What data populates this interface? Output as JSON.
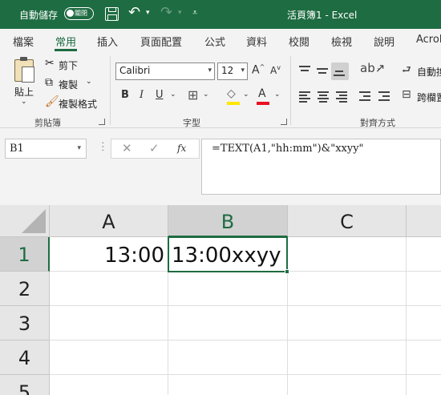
{
  "titlebar": {
    "autosave_label": "自動儲存",
    "autosave_state": "關閉",
    "document_title": "活頁簿1 - Excel",
    "background": "#1e6c41"
  },
  "tabs": [
    {
      "label": "檔案"
    },
    {
      "label": "常用",
      "active": true
    },
    {
      "label": "插入"
    },
    {
      "label": "頁面配置"
    },
    {
      "label": "公式"
    },
    {
      "label": "資料"
    },
    {
      "label": "校閱"
    },
    {
      "label": "檢視"
    },
    {
      "label": "說明"
    },
    {
      "label": "Acrob"
    }
  ],
  "ribbon": {
    "clipboard": {
      "paste_label": "貼上",
      "cut_label": "剪下",
      "copy_label": "複製",
      "format_painter_label": "複製格式",
      "group_label": "剪貼簿"
    },
    "font": {
      "font_name": "Calibri",
      "font_size": "12",
      "group_label": "字型",
      "bold": "B",
      "italic": "I",
      "underline": "U",
      "font_color": "#e81123",
      "fill_color": "#ffe600"
    },
    "alignment": {
      "wrap_text_label": "自動換",
      "merge_label": "跨欄置",
      "group_label": "對齊方式"
    }
  },
  "formula_bar": {
    "name_box": "B1",
    "formula": "=TEXT(A1,\"hh:mm\")&\"xxyy\""
  },
  "grid": {
    "columns": [
      "A",
      "B",
      "C"
    ],
    "rows": [
      "1",
      "2",
      "3",
      "4",
      "5"
    ],
    "cells": {
      "A1": "13:00",
      "B1": "13:00xxyy"
    },
    "selected_cell": "B1",
    "selection_color": "#1e6c41"
  }
}
